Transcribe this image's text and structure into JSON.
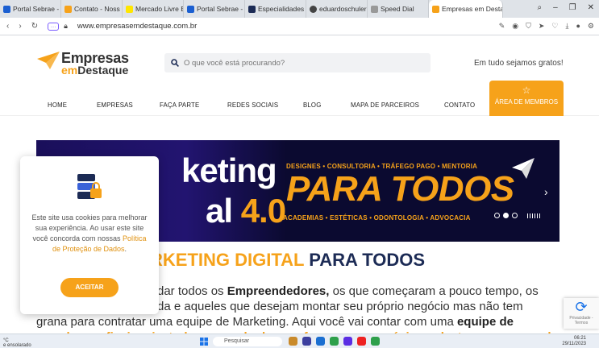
{
  "browser": {
    "tabs": [
      {
        "title": "Portal Sebrae -",
        "color": "#1b5fd1"
      },
      {
        "title": "Contato - Noss",
        "color": "#f6a21a"
      },
      {
        "title": "Mercado Livre E",
        "color": "#ffe600"
      },
      {
        "title": "Portal Sebrae -",
        "color": "#1b5fd1"
      },
      {
        "title": "Especialidades",
        "color": "#1c2b55"
      },
      {
        "title": "eduardoschuler",
        "color": "#444"
      },
      {
        "title": "Speed Dial",
        "color": "#999"
      },
      {
        "title": "Empresas em Desta",
        "color": "#f6a21a"
      }
    ],
    "url": "www.empresasemdestaque.com.br"
  },
  "site": {
    "logo_line1": "Empresas",
    "logo_em": "em",
    "logo_line2": "Destaque",
    "search_placeholder": "O que você está procurando?",
    "tagline": "Em tudo sejamos gratos!",
    "menu": [
      "HOME",
      "EMPRESAS",
      "FAÇA PARTE",
      "REDES SOCIAIS",
      "BLOG",
      "MAPA DE PARCEIROS",
      "CONTATO"
    ],
    "members_label": "ÁREA DE MEMBROS",
    "accent": "#f6a21a",
    "dark": "#1c2b55"
  },
  "banner": {
    "text_line1": "keting",
    "text_line2_word": "al",
    "text_line2_num": "4.0",
    "top_line": "DESIGNES • CONSULTORIA • TRÁFEGO PAGO • MENTORIA",
    "big": "PARA TODOS",
    "bottom_line": "ACADEMIAS • ESTÉTICAS • ODONTOLOGIA • ADVOCACIA",
    "next_icon": "chevron-right-icon"
  },
  "content": {
    "headline_orange": "RKETING DIGITAL",
    "headline_dark": "PARA TODOS",
    "p1_a": "dar todos os ",
    "p1_b": "Empreendedores,",
    "p1_c": " os que começaram a pouco tempo, os",
    "p2": "da e aqueles que desejam montar seu próprio negócio mas não tem",
    "p3_a": "grana para contratar uma equipe de Marketing. Aqui você vai contar com uma ",
    "p3_b": "equipe de",
    "p4": "grandes profissionais, todos empenhados em fazer o seu negócio se destacar no mercado"
  },
  "cookie": {
    "text": "Este site usa cookies para melhorar sua experiência. Ao usar este site você concorda com nossas ",
    "link": "Política de Proteção de Dados",
    "end": ".",
    "button": "ACEITAR"
  },
  "recaptcha": {
    "label": "Privacidade - Termos"
  },
  "taskbar": {
    "left_line1": "°C",
    "left_line2": "e ensolarado",
    "search": "Pesquisar",
    "time": "06:21",
    "date": "29/11/2023"
  }
}
